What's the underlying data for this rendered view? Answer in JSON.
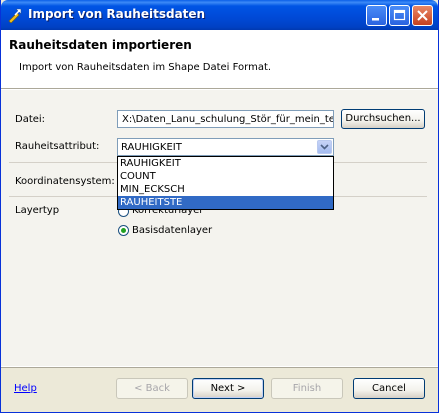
{
  "window": {
    "title": "Import von Rauheitsdaten",
    "icon": "import-icon"
  },
  "header": {
    "title": "Rauheitsdaten importieren",
    "description": "Import von Rauheitsdaten im Shape Datei Format."
  },
  "form": {
    "file_label": "Datei:",
    "file_value": "X:\\Daten_Lanu_schulung_Stör_für_mein_te",
    "browse_label": "Durchsuchen...",
    "attribute_label": "Rauheitsattribut:",
    "attribute_selected": "RAUHIGKEIT",
    "attribute_options": [
      "RAUHIGKEIT",
      "COUNT",
      "MIN_ECKSCH",
      "RAUHEITSTE"
    ],
    "attribute_highlighted": "RAUHEITSTE",
    "coords_label": "Koordinatensystem:",
    "layertype_label": "Layertyp",
    "radio_options": [
      "Korrekturlayer",
      "Basisdatenlayer"
    ],
    "radio_selected": "Basisdatenlayer"
  },
  "footer": {
    "help": "Help",
    "back": "< Back",
    "next": "Next >",
    "finish": "Finish",
    "cancel": "Cancel"
  }
}
